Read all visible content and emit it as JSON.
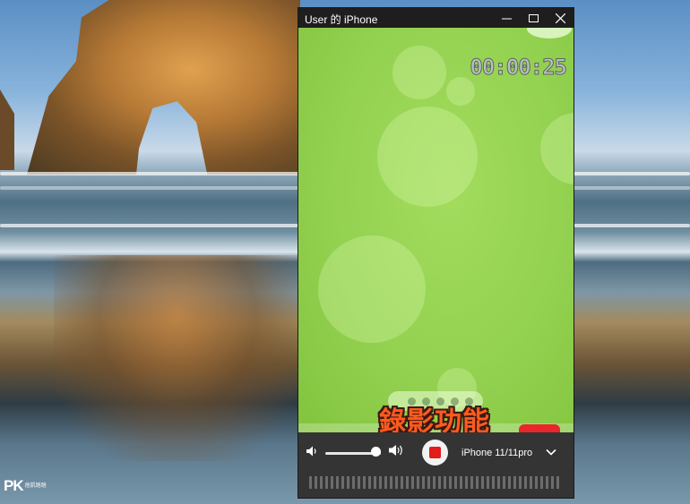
{
  "window": {
    "title": "User 的 iPhone"
  },
  "screen": {
    "timer": "00:00:25",
    "caption": "錄影功能"
  },
  "controls": {
    "volume_level": 0.9,
    "device_name": "iPhone 11/11pro",
    "record_color": "#e21b1b"
  },
  "watermark": {
    "brand": "PK",
    "tag": "痞凱踏踏"
  },
  "icons": [
    "minimize-icon",
    "maximize-icon",
    "close-icon",
    "volume-low-icon",
    "volume-high-icon",
    "record-stop-icon",
    "chevron-down-icon"
  ]
}
